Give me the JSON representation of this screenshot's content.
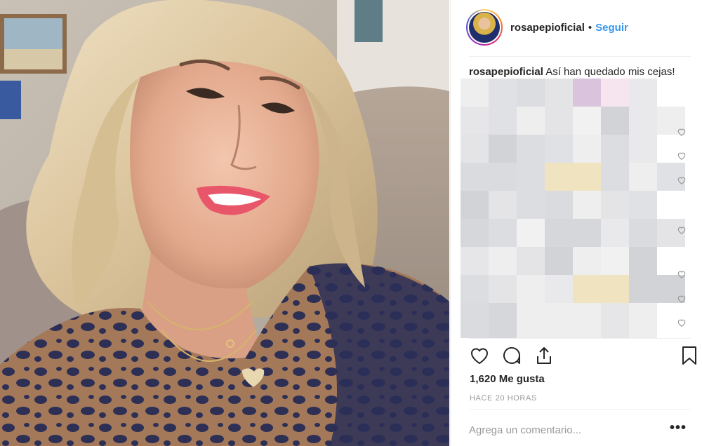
{
  "post": {
    "username": "rosapepioficial",
    "separator": "•",
    "follow_label": "Seguir",
    "caption_username": "rosapepioficial",
    "caption_text": "Así han quedado mis cejas!",
    "likes": "1,620 Me gusta",
    "timestamp": "HACE 20 HORAS",
    "comment_placeholder": "Agrega un comentario...",
    "more_label": "•••"
  },
  "photo": {
    "subject": "selfie of a smiling woman with blonde hair",
    "top_color": "leopard-print"
  },
  "icons": {
    "like": "heart-icon",
    "comment": "comment-icon",
    "share": "share-icon",
    "save": "bookmark-icon"
  },
  "colors": {
    "follow": "#3897f0",
    "text": "#262626",
    "muted": "#999999",
    "divider": "#efefef"
  }
}
